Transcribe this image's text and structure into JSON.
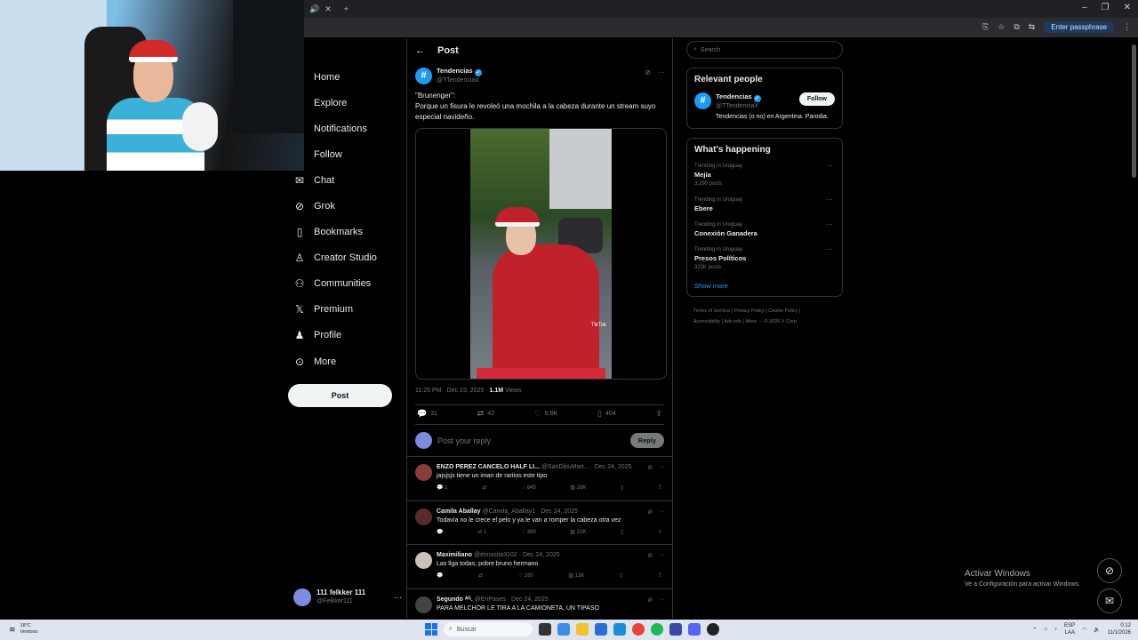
{
  "browser": {
    "passphrase_label": "Enter passphrase"
  },
  "sidebar": {
    "items": [
      {
        "label": "Home",
        "icon": "home-icon"
      },
      {
        "label": "Explore",
        "icon": "search-icon"
      },
      {
        "label": "Notifications",
        "icon": "bell-icon"
      },
      {
        "label": "Follow",
        "icon": "person-add-icon"
      },
      {
        "label": "Chat",
        "icon": "envelope-icon"
      },
      {
        "label": "Grok",
        "icon": "grok-icon"
      },
      {
        "label": "Bookmarks",
        "icon": "bookmark-icon"
      },
      {
        "label": "Creator Studio",
        "icon": "creator-icon"
      },
      {
        "label": "Communities",
        "icon": "communities-icon"
      },
      {
        "label": "Premium",
        "icon": "x-logo-icon"
      },
      {
        "label": "Profile",
        "icon": "person-icon"
      },
      {
        "label": "More",
        "icon": "more-circle-icon"
      }
    ],
    "post_label": "Post",
    "account": {
      "name": "111 felkker 111",
      "handle": "@Felkker111"
    }
  },
  "main": {
    "title": "Post",
    "tweet": {
      "name": "Tendencias",
      "handle": "@TTendenciaX",
      "text_line1": "\"Brunenger\":",
      "text_line2": "Porque un fisura le revoleó una mochila a la cabeza durante un stream suyo especial navideño.",
      "watermark": "TikTok",
      "time": "11:25 PM · Dec 23, 2025 · ",
      "views_count": "1.1M",
      "views_label": " Views",
      "replies": "31",
      "reposts": "42",
      "likes": "6.8K",
      "bookmarks": "404"
    },
    "reply_placeholder": "Post your reply",
    "reply_button": "Reply",
    "replies": [
      {
        "name": "ENZO PEREZ CANCELO HALF LI...",
        "meta": " @SanDibuMart... · Dec 24, 2025",
        "text": "jajsjsjs tiene un iman de raritos este tipo",
        "replies": "1",
        "reposts": "",
        "likes": "645",
        "views": "28K",
        "avatar_color": "#8a3b3b"
      },
      {
        "name": "Camila Aballay",
        "meta": " @Camila_Aballay1 · Dec 24, 2025",
        "text": "Todavía no le crece el pelo y ya le van a romper la cabeza otra vez",
        "replies": "",
        "reposts": "1",
        "likes": "385",
        "views": "22K",
        "avatar_color": "#5a2a2a"
      },
      {
        "name": "Maximiliano",
        "meta": " @elmasita3102 · Dec 24, 2025",
        "text": "Las llga todas, pobre bruno hermano",
        "replies": "",
        "reposts": "",
        "likes": "160",
        "views": "13K",
        "avatar_color": "#c9c3b6"
      },
      {
        "name": "Segundo ᴬᴳ.",
        "meta": " @EnPases · Dec 24, 2025",
        "text": "PARA MELCHOR LE TIRA A LA CAMIONETA, UN TIPASO",
        "replies": "",
        "reposts": "",
        "likes": "",
        "views": "",
        "avatar_color": "#444"
      }
    ]
  },
  "right": {
    "search_placeholder": "Search",
    "relevant_title": "Relevant people",
    "relevant": {
      "name": "Tendencias",
      "handle": "@TTendenciaX",
      "bio": "Tendencias (o no) en Argentina. Parodia.",
      "follow_label": "Follow"
    },
    "happening_title": "What's happening",
    "trends": [
      {
        "context": "Trending in Uruguay",
        "name": "Mejía",
        "count": "3,290 posts"
      },
      {
        "context": "Trending in Uruguay",
        "name": "Ebere",
        "count": ""
      },
      {
        "context": "Trending in Uruguay",
        "name": "Conexión Ganadera",
        "count": ""
      },
      {
        "context": "Trending in Uruguay",
        "name": "Presos Políticos",
        "count": "320K posts"
      }
    ],
    "show_more": "Show more",
    "footer_line1": "Terms of Service  |  Privacy Policy  |  Cookie Policy  |",
    "footer_line2": "Accessibility  |  Ads info  |  More ···  © 2026 X Corp."
  },
  "windows": {
    "activate_title": "Activar Windows",
    "activate_sub": "Ve a Configuración para activar Windows."
  },
  "taskbar": {
    "weather_temp": "18°C",
    "weather_desc": "Ventoso",
    "search_label": "Buscar",
    "lang1": "ESP",
    "lang2": "LAA",
    "time": "0:12",
    "date": "11/1/2026"
  }
}
